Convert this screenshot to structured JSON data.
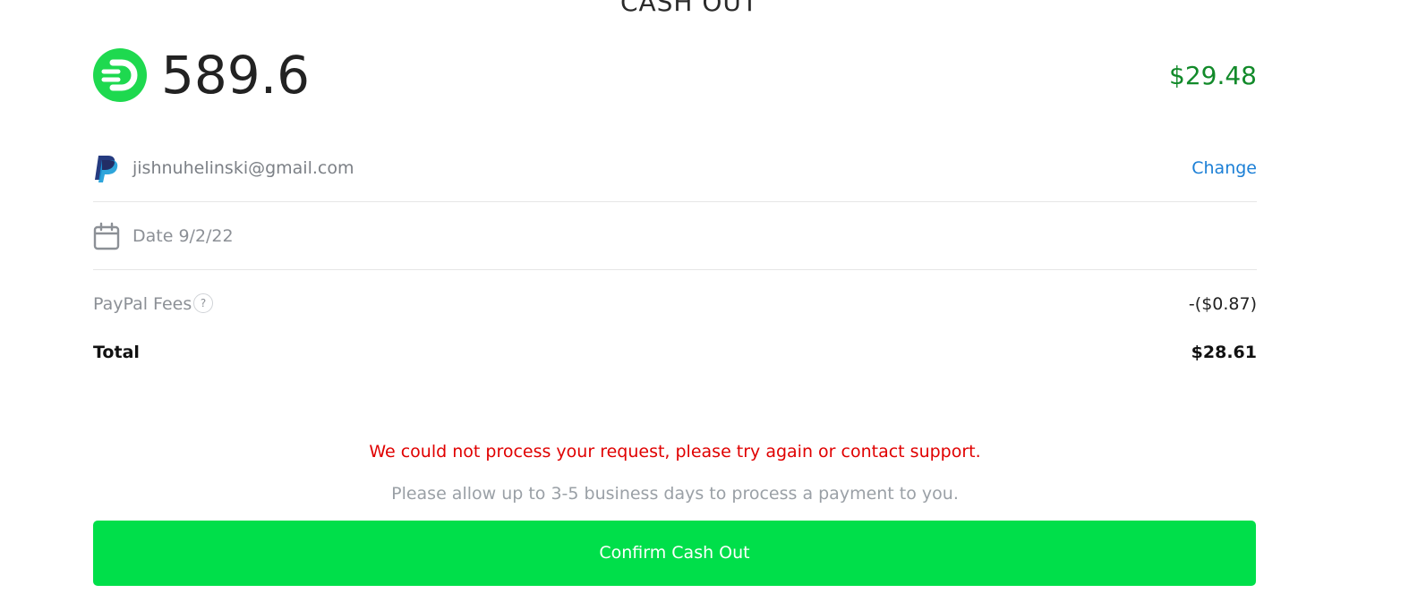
{
  "header": {
    "title": "CASH OUT"
  },
  "balance": {
    "points": "589.6",
    "dollar_value": "$29.48",
    "logo_icon": "points-logo-icon",
    "accent_color": "#00df4a"
  },
  "payout_method": {
    "icon": "paypal-icon",
    "email": "jishnuhelinski@gmail.com",
    "change_label": "Change"
  },
  "date_row": {
    "icon": "calendar-icon",
    "text": "Date 9/2/22"
  },
  "fees": {
    "label": "PayPal Fees",
    "help_glyph": "?",
    "value": "-($0.87)"
  },
  "total": {
    "label": "Total",
    "value": "$28.61"
  },
  "messages": {
    "error": "We could not process your request, please try again or contact support.",
    "notice": "Please allow up to 3-5 business days to process a payment to you."
  },
  "actions": {
    "confirm_label": "Confirm Cash Out"
  }
}
